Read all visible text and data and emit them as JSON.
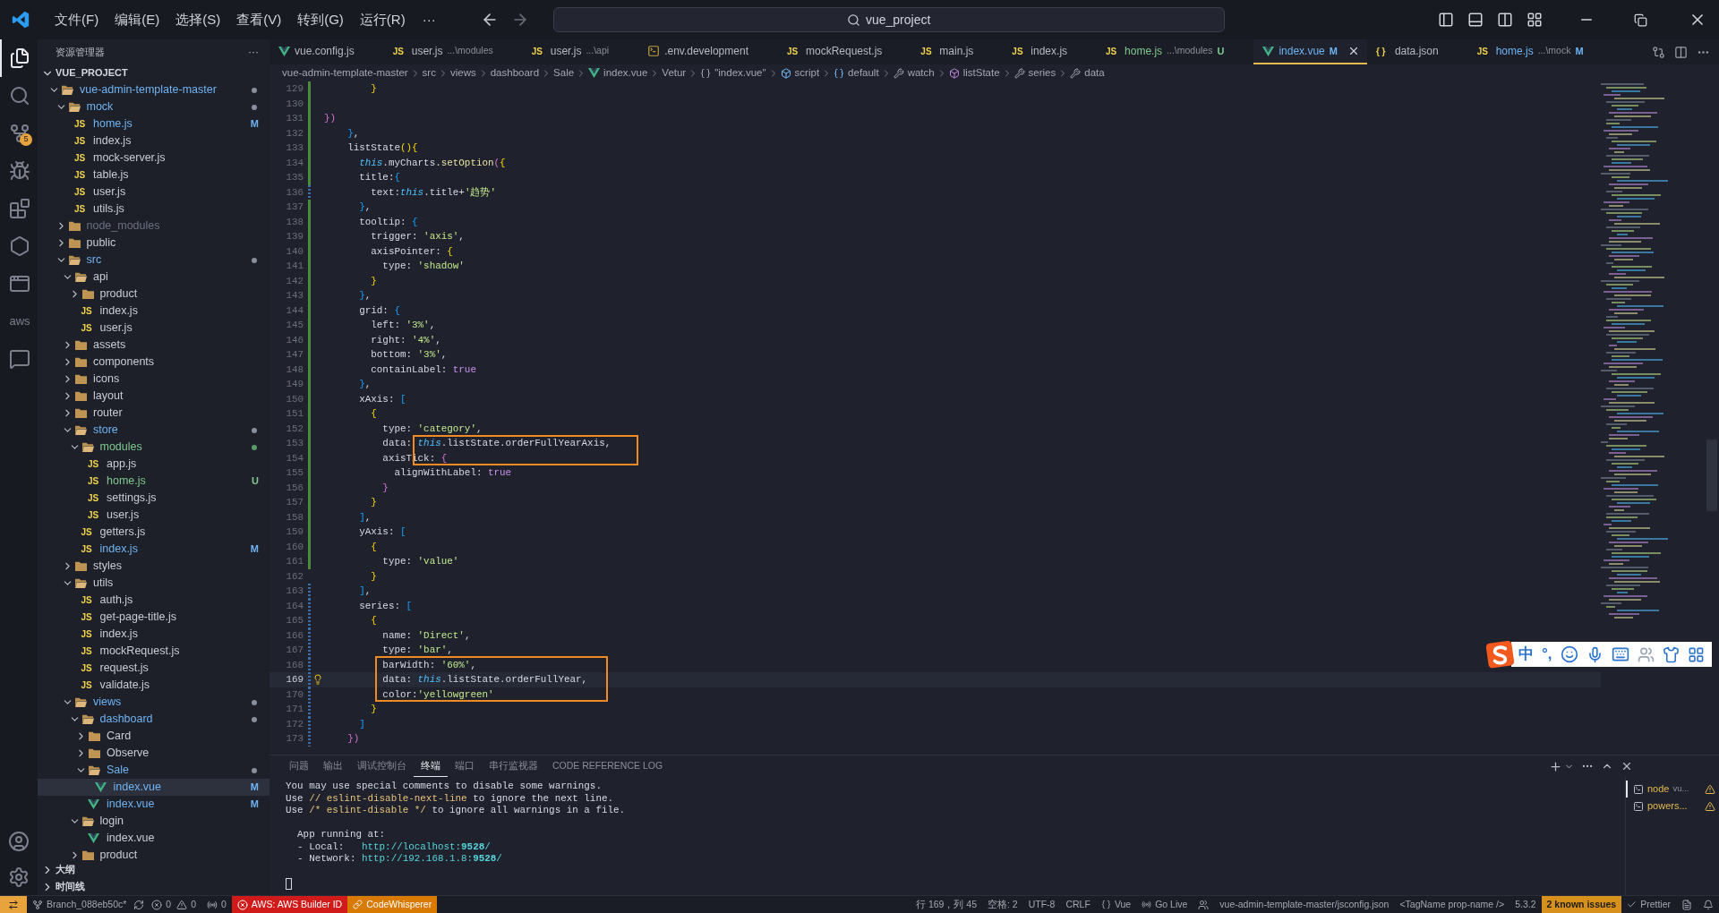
{
  "title_bar": {
    "menus": [
      "文件(F)",
      "编辑(E)",
      "选择(S)",
      "查看(V)",
      "转到(G)",
      "运行(R)"
    ],
    "more": "···",
    "search": "vue_project"
  },
  "activity_bar": {
    "items": [
      {
        "kind": "explorer",
        "selected": true
      },
      {
        "kind": "search",
        "selected": false
      },
      {
        "kind": "source-control",
        "selected": false,
        "badge": "5"
      },
      {
        "kind": "run",
        "selected": false
      },
      {
        "kind": "extensions",
        "selected": false
      },
      {
        "kind": "hexagon",
        "selected": false
      },
      {
        "kind": "browser",
        "selected": false
      },
      {
        "kind": "aws",
        "selected": false,
        "label": "aws"
      },
      {
        "kind": "chat",
        "selected": false
      }
    ],
    "bottom": [
      {
        "kind": "account"
      },
      {
        "kind": "settings"
      }
    ]
  },
  "sidebar": {
    "title": "资源管理器",
    "more": "···",
    "project": {
      "name": "VUE_PROJECT",
      "expanded": true
    },
    "tree": [
      {
        "name": "vue-admin-template-master",
        "kind": "folder",
        "expanded": true,
        "color": "#6fb3f2",
        "dot": {
          "color": "#8a8f9c"
        },
        "selected": false,
        "children": [
          {
            "name": "mock",
            "kind": "folder",
            "expanded": true,
            "color": "#6fb3f2",
            "dot": {
              "color": "#8a8f9c"
            },
            "selected": false,
            "children": [
              {
                "name": "home.js",
                "kind": "js",
                "icon": "JS",
                "color": "#6fb3f2",
                "badge": "M",
                "selected": false
              },
              {
                "name": "index.js",
                "kind": "js",
                "icon": "JS",
                "color": "#c9ccd4",
                "selected": false
              },
              {
                "name": "mock-server.js",
                "kind": "js",
                "icon": "JS",
                "color": "#c9ccd4",
                "selected": false
              },
              {
                "name": "table.js",
                "kind": "js",
                "icon": "JS",
                "color": "#c9ccd4",
                "selected": false
              },
              {
                "name": "user.js",
                "kind": "js",
                "icon": "JS",
                "color": "#c9ccd4",
                "selected": false
              },
              {
                "name": "utils.js",
                "kind": "js",
                "icon": "JS",
                "color": "#c9ccd4",
                "selected": false
              }
            ]
          },
          {
            "name": "node_modules",
            "kind": "folder",
            "expanded": false,
            "color": "#6b7080",
            "selected": false
          },
          {
            "name": "public",
            "kind": "folder",
            "expanded": false,
            "color": "#c9ccd4",
            "selected": false
          },
          {
            "name": "src",
            "kind": "folder",
            "expanded": true,
            "color": "#6fb3f2",
            "dot": {
              "color": "#8a8f9c"
            },
            "selected": false,
            "children": [
              {
                "name": "api",
                "kind": "folder",
                "expanded": true,
                "color": "#c9ccd4",
                "selected": false,
                "children": [
                  {
                    "name": "product",
                    "kind": "folder",
                    "expanded": false,
                    "color": "#c9ccd4",
                    "selected": false
                  },
                  {
                    "name": "index.js",
                    "kind": "js",
                    "icon": "JS",
                    "color": "#c9ccd4",
                    "selected": false
                  },
                  {
                    "name": "user.js",
                    "kind": "js",
                    "icon": "JS",
                    "color": "#c9ccd4",
                    "selected": false
                  }
                ]
              },
              {
                "name": "assets",
                "kind": "folder",
                "expanded": false,
                "color": "#c9ccd4",
                "selected": false
              },
              {
                "name": "components",
                "kind": "folder",
                "expanded": false,
                "color": "#c9ccd4",
                "selected": false
              },
              {
                "name": "icons",
                "kind": "folder",
                "expanded": false,
                "color": "#c9ccd4",
                "selected": false
              },
              {
                "name": "layout",
                "kind": "folder",
                "expanded": false,
                "color": "#c9ccd4",
                "selected": false
              },
              {
                "name": "router",
                "kind": "folder",
                "expanded": false,
                "color": "#c9ccd4",
                "selected": false
              },
              {
                "name": "store",
                "kind": "folder",
                "expanded": true,
                "color": "#6fb3f2",
                "dot": {
                  "color": "#8a8f9c"
                },
                "selected": false,
                "children": [
                  {
                    "name": "modules",
                    "kind": "folder",
                    "expanded": true,
                    "color": "#7fc98f",
                    "dot": {
                      "color": "#5a9a66"
                    },
                    "selected": false,
                    "children": [
                      {
                        "name": "app.js",
                        "kind": "js",
                        "icon": "JS",
                        "color": "#c9ccd4",
                        "selected": false
                      },
                      {
                        "name": "home.js",
                        "kind": "js",
                        "icon": "JS",
                        "color": "#7fc98f",
                        "badge": "U",
                        "selected": false
                      },
                      {
                        "name": "settings.js",
                        "kind": "js",
                        "icon": "JS",
                        "color": "#c9ccd4",
                        "selected": false
                      },
                      {
                        "name": "user.js",
                        "kind": "js",
                        "icon": "JS",
                        "color": "#c9ccd4",
                        "selected": false
                      }
                    ]
                  },
                  {
                    "name": "getters.js",
                    "kind": "js",
                    "icon": "JS",
                    "color": "#c9ccd4",
                    "selected": false
                  },
                  {
                    "name": "index.js",
                    "kind": "js",
                    "icon": "JS",
                    "color": "#6fb3f2",
                    "badge": "M",
                    "selected": false
                  }
                ]
              },
              {
                "name": "styles",
                "kind": "folder",
                "expanded": false,
                "color": "#c9ccd4",
                "selected": false
              },
              {
                "name": "utils",
                "kind": "folder",
                "expanded": true,
                "color": "#c9ccd4",
                "selected": false,
                "children": [
                  {
                    "name": "auth.js",
                    "kind": "js",
                    "icon": "JS",
                    "color": "#c9ccd4",
                    "selected": false
                  },
                  {
                    "name": "get-page-title.js",
                    "kind": "js",
                    "icon": "JS",
                    "color": "#c9ccd4",
                    "selected": false
                  },
                  {
                    "name": "index.js",
                    "kind": "js",
                    "icon": "JS",
                    "color": "#c9ccd4",
                    "selected": false
                  },
                  {
                    "name": "mockRequest.js",
                    "kind": "js",
                    "icon": "JS",
                    "color": "#c9ccd4",
                    "selected": false
                  },
                  {
                    "name": "request.js",
                    "kind": "js",
                    "icon": "JS",
                    "color": "#c9ccd4",
                    "selected": false
                  },
                  {
                    "name": "validate.js",
                    "kind": "js",
                    "icon": "JS",
                    "color": "#c9ccd4",
                    "selected": false
                  }
                ]
              },
              {
                "name": "views",
                "kind": "folder",
                "expanded": true,
                "color": "#6fb3f2",
                "dot": {
                  "color": "#8a8f9c"
                },
                "selected": false,
                "children": [
                  {
                    "name": "dashboard",
                    "kind": "folder",
                    "expanded": true,
                    "color": "#6fb3f2",
                    "dot": {
                      "color": "#8a8f9c"
                    },
                    "selected": false,
                    "children": [
                      {
                        "name": "Card",
                        "kind": "folder",
                        "expanded": false,
                        "color": "#c9ccd4",
                        "selected": false
                      },
                      {
                        "name": "Observe",
                        "kind": "folder",
                        "expanded": false,
                        "color": "#c9ccd4",
                        "selected": false
                      },
                      {
                        "name": "Sale",
                        "kind": "folder",
                        "expanded": true,
                        "color": "#6fb3f2",
                        "dot": {
                          "color": "#8a8f9c"
                        },
                        "selected": false,
                        "children": [
                          {
                            "name": "index.vue",
                            "kind": "vue",
                            "color": "#6fb3f2",
                            "badge": "M",
                            "selected": true
                          }
                        ]
                      },
                      {
                        "name": "index.vue",
                        "kind": "vue",
                        "color": "#6fb3f2",
                        "badge": "M",
                        "selected": false
                      }
                    ]
                  },
                  {
                    "name": "login",
                    "kind": "folder",
                    "expanded": true,
                    "color": "#c9ccd4",
                    "selected": false,
                    "children": [
                      {
                        "name": "index.vue",
                        "kind": "vue",
                        "color": "#c9ccd4",
                        "selected": false
                      }
                    ]
                  },
                  {
                    "name": "product",
                    "kind": "folder",
                    "expanded": false,
                    "color": "#c9ccd4",
                    "selected": false
                  }
                ]
              }
            ]
          }
        ]
      }
    ],
    "sections": [
      {
        "name": "大纲",
        "expanded": false
      },
      {
        "name": "时间线",
        "expanded": false
      }
    ]
  },
  "tabs": [
    {
      "name": "vue.config.js",
      "kind": "vue",
      "color": "#b4b8c2",
      "selected": false
    },
    {
      "name": "user.js",
      "hint": "...\\modules",
      "kind": "js",
      "icon": "JS",
      "color": "#b4b8c2",
      "selected": false
    },
    {
      "name": "user.js",
      "hint": "...\\api",
      "kind": "js",
      "icon": "JS",
      "color": "#b4b8c2",
      "selected": false
    },
    {
      "name": ".env.development",
      "kind": "env",
      "color": "#b4b8c2",
      "selected": false
    },
    {
      "name": "mockRequest.js",
      "kind": "js",
      "icon": "JS",
      "color": "#b4b8c2",
      "selected": false
    },
    {
      "name": "main.js",
      "kind": "js",
      "icon": "JS",
      "color": "#b4b8c2",
      "selected": false
    },
    {
      "name": "index.js",
      "kind": "js",
      "icon": "JS",
      "color": "#b4b8c2",
      "selected": false
    },
    {
      "name": "home.js",
      "hint": "...\\modules",
      "badge": "U",
      "kind": "js",
      "icon": "JS",
      "color": "#7fc98f",
      "selected": false
    },
    {
      "name": "index.vue",
      "badge": "M",
      "kind": "vue",
      "color": "#6fb3f2",
      "selected": true
    },
    {
      "name": "data.json",
      "kind": "json",
      "icon": "{ }",
      "color": "#b4b8c2",
      "selected": false
    },
    {
      "name": "home.js",
      "hint": "...\\mock",
      "badge": "M",
      "kind": "js",
      "icon": "JS",
      "color": "#6fb3f2",
      "selected": false
    }
  ],
  "breadcrumb": [
    {
      "text": "vue-admin-template-master",
      "kind": "plain"
    },
    {
      "text": "src",
      "kind": "plain"
    },
    {
      "text": "views",
      "kind": "plain"
    },
    {
      "text": "dashboard",
      "kind": "plain"
    },
    {
      "text": "Sale",
      "kind": "plain"
    },
    {
      "text": "index.vue",
      "kind": "vue"
    },
    {
      "text": "Vetur",
      "kind": "plain"
    },
    {
      "text": "\"index.vue\"",
      "kind": "braces"
    },
    {
      "text": "script",
      "kind": "module"
    },
    {
      "text": "default",
      "kind": "default"
    },
    {
      "text": "watch",
      "kind": "key"
    },
    {
      "text": "listState",
      "kind": "method"
    },
    {
      "text": "series",
      "kind": "key"
    },
    {
      "text": "data",
      "kind": "key"
    }
  ],
  "editor": {
    "lines": [
      {
        "number": "129",
        "kind": "added",
        "current": false,
        "spans": [
          {
            "kind": "bracket-gold",
            "text": "        }"
          }
        ]
      },
      {
        "number": "130",
        "kind": "added",
        "current": false
      },
      {
        "number": "131",
        "kind": "added",
        "current": false,
        "spans": [
          {
            "kind": "bracket-pink",
            "text": "})"
          }
        ]
      },
      {
        "number": "132",
        "kind": "added",
        "current": false,
        "spans": [
          {
            "kind": "bracket-blue",
            "text": "    }"
          },
          {
            "kind": "plain",
            "text": ","
          }
        ]
      },
      {
        "number": "133",
        "kind": "added",
        "current": false,
        "spans": [
          {
            "kind": "plain",
            "text": "    listState"
          },
          {
            "kind": "bracket-gold",
            "text": "(){"
          }
        ]
      },
      {
        "number": "134",
        "kind": "added",
        "current": false,
        "spans": [
          {
            "kind": "this",
            "text": "      this"
          },
          {
            "kind": "plain",
            "text": ".myCharts."
          },
          {
            "kind": "function",
            "text": "setOption"
          },
          {
            "kind": "bracket-pink",
            "text": "("
          },
          {
            "kind": "bracket-gold",
            "text": "{"
          }
        ]
      },
      {
        "number": "135",
        "kind": "added",
        "current": false,
        "spans": [
          {
            "kind": "plain",
            "text": "      title:"
          },
          {
            "kind": "bracket-blue",
            "text": "{"
          }
        ]
      },
      {
        "number": "136",
        "kind": "modified",
        "current": false,
        "spans": [
          {
            "kind": "plain",
            "text": "        text:"
          },
          {
            "kind": "this",
            "text": "this"
          },
          {
            "kind": "plain",
            "text": ".title+"
          },
          {
            "kind": "string",
            "text": "'趋势'"
          }
        ]
      },
      {
        "number": "137",
        "kind": "added",
        "current": false,
        "spans": [
          {
            "kind": "bracket-blue",
            "text": "      }"
          },
          {
            "kind": "plain",
            "text": ","
          }
        ]
      },
      {
        "number": "138",
        "kind": "added",
        "current": false,
        "spans": [
          {
            "kind": "plain",
            "text": "      tooltip: "
          },
          {
            "kind": "bracket-blue",
            "text": "{"
          }
        ]
      },
      {
        "number": "139",
        "kind": "added",
        "current": false,
        "spans": [
          {
            "kind": "plain",
            "text": "        trigger: "
          },
          {
            "kind": "string",
            "text": "'axis'"
          },
          {
            "kind": "plain",
            "text": ","
          }
        ]
      },
      {
        "number": "140",
        "kind": "added",
        "current": false,
        "spans": [
          {
            "kind": "plain",
            "text": "        axisPointer: "
          },
          {
            "kind": "bracket-gold",
            "text": "{"
          }
        ]
      },
      {
        "number": "141",
        "kind": "added",
        "current": false,
        "spans": [
          {
            "kind": "plain",
            "text": "          type: "
          },
          {
            "kind": "string",
            "text": "'shadow'"
          }
        ]
      },
      {
        "number": "142",
        "kind": "added",
        "current": false,
        "spans": [
          {
            "kind": "bracket-gold",
            "text": "        }"
          }
        ]
      },
      {
        "number": "143",
        "kind": "added",
        "current": false,
        "spans": [
          {
            "kind": "bracket-blue",
            "text": "      }"
          },
          {
            "kind": "plain",
            "text": ","
          }
        ]
      },
      {
        "number": "144",
        "kind": "added",
        "current": false,
        "spans": [
          {
            "kind": "plain",
            "text": "      grid: "
          },
          {
            "kind": "bracket-blue",
            "text": "{"
          }
        ]
      },
      {
        "number": "145",
        "kind": "added",
        "current": false,
        "spans": [
          {
            "kind": "plain",
            "text": "        left: "
          },
          {
            "kind": "string",
            "text": "'3%'"
          },
          {
            "kind": "plain",
            "text": ","
          }
        ]
      },
      {
        "number": "146",
        "kind": "added",
        "current": false,
        "spans": [
          {
            "kind": "plain",
            "text": "        right: "
          },
          {
            "kind": "string",
            "text": "'4%'"
          },
          {
            "kind": "plain",
            "text": ","
          }
        ]
      },
      {
        "number": "147",
        "kind": "added",
        "current": false,
        "spans": [
          {
            "kind": "plain",
            "text": "        bottom: "
          },
          {
            "kind": "string",
            "text": "'3%'"
          },
          {
            "kind": "plain",
            "text": ","
          }
        ]
      },
      {
        "number": "148",
        "kind": "added",
        "current": false,
        "spans": [
          {
            "kind": "plain",
            "text": "        containLabel: "
          },
          {
            "kind": "keyword",
            "text": "true"
          }
        ]
      },
      {
        "number": "149",
        "kind": "added",
        "current": false,
        "spans": [
          {
            "kind": "bracket-blue",
            "text": "      }"
          },
          {
            "kind": "plain",
            "text": ","
          }
        ]
      },
      {
        "number": "150",
        "kind": "added",
        "current": false,
        "spans": [
          {
            "kind": "plain",
            "text": "      xAxis: "
          },
          {
            "kind": "bracket-blue",
            "text": "["
          }
        ]
      },
      {
        "number": "151",
        "kind": "added",
        "current": false,
        "spans": [
          {
            "kind": "bracket-gold",
            "text": "        {"
          }
        ]
      },
      {
        "number": "152",
        "kind": "added",
        "current": false,
        "spans": [
          {
            "kind": "plain",
            "text": "          type: "
          },
          {
            "kind": "string",
            "text": "'category'"
          },
          {
            "kind": "plain",
            "text": ","
          }
        ]
      },
      {
        "number": "153",
        "kind": "added",
        "current": false,
        "spans": [
          {
            "kind": "plain",
            "text": "          data: "
          },
          {
            "kind": "this",
            "text": "this"
          },
          {
            "kind": "plain",
            "text": ".listState.orderFullYearAxis,"
          }
        ]
      },
      {
        "number": "154",
        "kind": "added",
        "current": false,
        "spans": [
          {
            "kind": "plain",
            "text": "          axisTick: "
          },
          {
            "kind": "bracket-pink",
            "text": "{"
          }
        ]
      },
      {
        "number": "155",
        "kind": "added",
        "current": false,
        "spans": [
          {
            "kind": "plain",
            "text": "            alignWithLabel: "
          },
          {
            "kind": "keyword",
            "text": "true"
          }
        ]
      },
      {
        "number": "156",
        "kind": "added",
        "current": false,
        "spans": [
          {
            "kind": "bracket-pink",
            "text": "          }"
          }
        ]
      },
      {
        "number": "157",
        "kind": "added",
        "current": false,
        "spans": [
          {
            "kind": "bracket-gold",
            "text": "        }"
          }
        ]
      },
      {
        "number": "158",
        "kind": "added",
        "current": false,
        "spans": [
          {
            "kind": "bracket-blue",
            "text": "      ]"
          },
          {
            "kind": "plain",
            "text": ","
          }
        ]
      },
      {
        "number": "159",
        "kind": "added",
        "current": false,
        "spans": [
          {
            "kind": "plain",
            "text": "      yAxis: "
          },
          {
            "kind": "bracket-blue",
            "text": "["
          }
        ]
      },
      {
        "number": "160",
        "kind": "added",
        "current": false,
        "spans": [
          {
            "kind": "bracket-gold",
            "text": "        {"
          }
        ]
      },
      {
        "number": "161",
        "kind": "added",
        "current": false,
        "spans": [
          {
            "kind": "plain",
            "text": "          type: "
          },
          {
            "kind": "string",
            "text": "'value'"
          }
        ]
      },
      {
        "number": "162",
        "kind": "unchanged",
        "current": false,
        "spans": [
          {
            "kind": "bracket-gold",
            "text": "        }"
          }
        ]
      },
      {
        "number": "163",
        "kind": "modified",
        "current": false,
        "spans": [
          {
            "kind": "bracket-blue",
            "text": "      ]"
          },
          {
            "kind": "plain",
            "text": ","
          }
        ]
      },
      {
        "number": "164",
        "kind": "modified",
        "current": false,
        "spans": [
          {
            "kind": "plain",
            "text": "      series: "
          },
          {
            "kind": "bracket-blue",
            "text": "["
          }
        ]
      },
      {
        "number": "165",
        "kind": "modified",
        "current": false,
        "spans": [
          {
            "kind": "bracket-gold",
            "text": "        {"
          }
        ]
      },
      {
        "number": "166",
        "kind": "modified",
        "current": false,
        "spans": [
          {
            "kind": "plain",
            "text": "          name: "
          },
          {
            "kind": "string",
            "text": "'Direct'"
          },
          {
            "kind": "plain",
            "text": ","
          }
        ]
      },
      {
        "number": "167",
        "kind": "modified",
        "current": false,
        "spans": [
          {
            "kind": "plain",
            "text": "          type: "
          },
          {
            "kind": "string",
            "text": "'bar'"
          },
          {
            "kind": "plain",
            "text": ","
          }
        ]
      },
      {
        "number": "168",
        "kind": "modified",
        "current": false,
        "spans": [
          {
            "kind": "plain",
            "text": "          barWidth: "
          },
          {
            "kind": "string",
            "text": "'60%'"
          },
          {
            "kind": "plain",
            "text": ","
          }
        ]
      },
      {
        "number": "169",
        "kind": "modified",
        "current": true,
        "spans": [
          {
            "kind": "plain",
            "text": "          data: "
          },
          {
            "kind": "this",
            "text": "this"
          },
          {
            "kind": "plain",
            "text": ".listState.orderFullYear,"
          }
        ]
      },
      {
        "number": "170",
        "kind": "modified",
        "current": false,
        "spans": [
          {
            "kind": "plain",
            "text": "          color:"
          },
          {
            "kind": "string",
            "text": "'yellowgreen'"
          }
        ]
      },
      {
        "number": "171",
        "kind": "modified",
        "current": false,
        "spans": [
          {
            "kind": "bracket-gold",
            "text": "        }"
          }
        ]
      },
      {
        "number": "172",
        "kind": "modified",
        "current": false,
        "spans": [
          {
            "kind": "bracket-blue",
            "text": "      ]"
          }
        ]
      },
      {
        "number": "173",
        "kind": "modified",
        "current": false,
        "spans": [
          {
            "kind": "bracket-pink",
            "text": "    })"
          }
        ]
      }
    ]
  },
  "ime_toolbar": {
    "mode": "中",
    "punctuation": "°,"
  },
  "panel": {
    "tabs": [
      {
        "label": "问题",
        "selected": false
      },
      {
        "label": "输出",
        "selected": false
      },
      {
        "label": "调试控制台",
        "selected": false
      },
      {
        "label": "终端",
        "selected": true
      },
      {
        "label": "端口",
        "selected": false
      },
      {
        "label": "串行监视器",
        "selected": false
      },
      {
        "label": "CODE REFERENCE LOG",
        "selected": false
      }
    ],
    "terminal": [
      {
        "kind": "text",
        "spans": [
          {
            "kind": "plain",
            "text": "You may use special comments to disable some warnings."
          }
        ]
      },
      {
        "kind": "text",
        "spans": [
          {
            "kind": "plain",
            "text": "Use "
          },
          {
            "kind": "comment",
            "text": "// eslint-disable-next-line"
          },
          {
            "kind": "plain",
            "text": " to ignore the next line."
          }
        ]
      },
      {
        "kind": "text",
        "spans": [
          {
            "kind": "plain",
            "text": "Use "
          },
          {
            "kind": "comment",
            "text": "/* eslint-disable */"
          },
          {
            "kind": "plain",
            "text": " to ignore all warnings in a file."
          }
        ]
      },
      {
        "kind": "blank"
      },
      {
        "kind": "text",
        "spans": [
          {
            "kind": "plain",
            "text": "  App running at:"
          }
        ]
      },
      {
        "kind": "text",
        "spans": [
          {
            "kind": "plain",
            "text": "  - Local:   "
          },
          {
            "kind": "url",
            "text": "http://localhost:"
          },
          {
            "kind": "port",
            "text": "9528"
          },
          {
            "kind": "url",
            "text": "/"
          }
        ]
      },
      {
        "kind": "text",
        "spans": [
          {
            "kind": "plain",
            "text": "  - Network: "
          },
          {
            "kind": "url",
            "text": "http://192.168.1.8:"
          },
          {
            "kind": "port",
            "text": "9528"
          },
          {
            "kind": "url",
            "text": "/"
          }
        ]
      },
      {
        "kind": "blank"
      },
      {
        "kind": "cursor"
      }
    ],
    "terminals": [
      {
        "name": "node",
        "hint": "vu...",
        "selected": true
      },
      {
        "name": "powers...",
        "selected": false
      }
    ]
  },
  "status_bar": {
    "left": [
      {
        "kind": "remote"
      },
      {
        "kind": "branch",
        "text": "Branch_088eb50c*"
      },
      {
        "kind": "sync"
      },
      {
        "kind": "problems",
        "errors": "0",
        "warnings": "0"
      },
      {
        "kind": "ports",
        "text": "0"
      },
      {
        "kind": "aws",
        "text": "AWS: AWS Builder ID"
      },
      {
        "kind": "codewhisperer",
        "text": "CodeWhisperer"
      }
    ],
    "right": [
      {
        "kind": "plain",
        "text": "行 169，列 45"
      },
      {
        "kind": "plain",
        "text": "空格: 2"
      },
      {
        "kind": "plain",
        "text": "UTF-8"
      },
      {
        "kind": "plain",
        "text": "CRLF"
      },
      {
        "kind": "language",
        "text": "Vue"
      },
      {
        "kind": "golive",
        "text": "Go Live"
      },
      {
        "kind": "people"
      },
      {
        "kind": "plain",
        "text": "vue-admin-template-master/jsconfig.json"
      },
      {
        "kind": "plain",
        "text": "<TagName prop-name />"
      },
      {
        "kind": "plain",
        "text": "5.3.2"
      },
      {
        "kind": "issues",
        "text": "2 known issues"
      },
      {
        "kind": "prettier",
        "text": "Prettier"
      },
      {
        "kind": "feedback"
      },
      {
        "kind": "bell"
      }
    ]
  }
}
